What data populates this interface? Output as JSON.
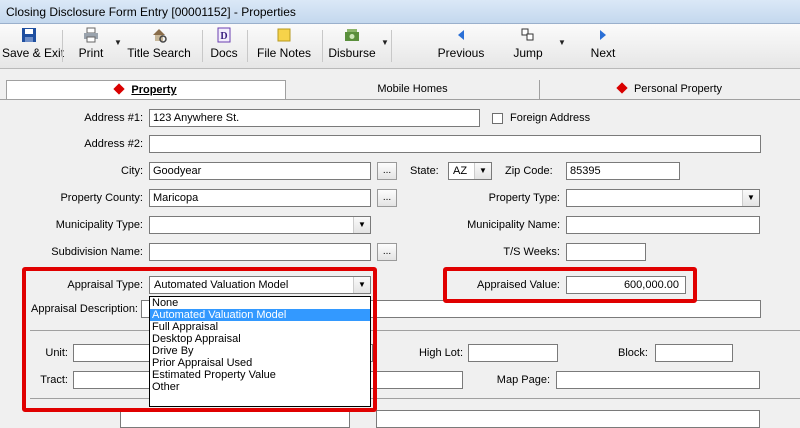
{
  "window": {
    "title": "Closing Disclosure Form Entry [00001152] - Properties"
  },
  "toolbar": {
    "save_exit": "Save & Exit",
    "print": "Print",
    "title_search": "Title Search",
    "docs": "Docs",
    "file_notes": "File Notes",
    "disburse": "Disburse",
    "previous": "Previous",
    "jump": "Jump",
    "next": "Next"
  },
  "tabs": {
    "property": "Property",
    "mobile_homes": "Mobile Homes",
    "personal_property": "Personal Property"
  },
  "form": {
    "address1_label": "Address #1:",
    "address1_value": "123 Anywhere St.",
    "foreign_address_label": "Foreign Address",
    "address2_label": "Address #2:",
    "address2_value": "",
    "city_label": "City:",
    "city_value": "Goodyear",
    "state_label": "State:",
    "state_value": "AZ",
    "zip_label": "Zip Code:",
    "zip_value": "85395",
    "county_label": "Property County:",
    "county_value": "Maricopa",
    "property_type_label": "Property Type:",
    "property_type_value": "",
    "municipality_type_label": "Municipality Type:",
    "municipality_type_value": "",
    "municipality_name_label": "Municipality Name:",
    "municipality_name_value": "",
    "subdivision_label": "Subdivision Name:",
    "subdivision_value": "",
    "ts_weeks_label": "T/S Weeks:",
    "ts_weeks_value": "",
    "appraisal_type_label": "Appraisal Type:",
    "appraisal_type_value": "Automated Valuation Model",
    "appraised_value_label": "Appraised Value:",
    "appraised_value_value": "600,000.00",
    "appraisal_desc_label": "Appraisal Description:",
    "unit_label": "Unit:",
    "high_lot_label": "High Lot:",
    "block_label": "Block:",
    "tract_label": "Tract:",
    "map_page_label": "Map Page:"
  },
  "appraisal_options": [
    "None",
    "Automated Valuation Model",
    "Full Appraisal",
    "Desktop Appraisal",
    "Drive By",
    "Prior Appraisal Used",
    "Estimated Property Value",
    "Other"
  ],
  "colors": {
    "highlight": "#e00000",
    "selected_option": "#3399ff",
    "tab_marker": "#d90000"
  }
}
